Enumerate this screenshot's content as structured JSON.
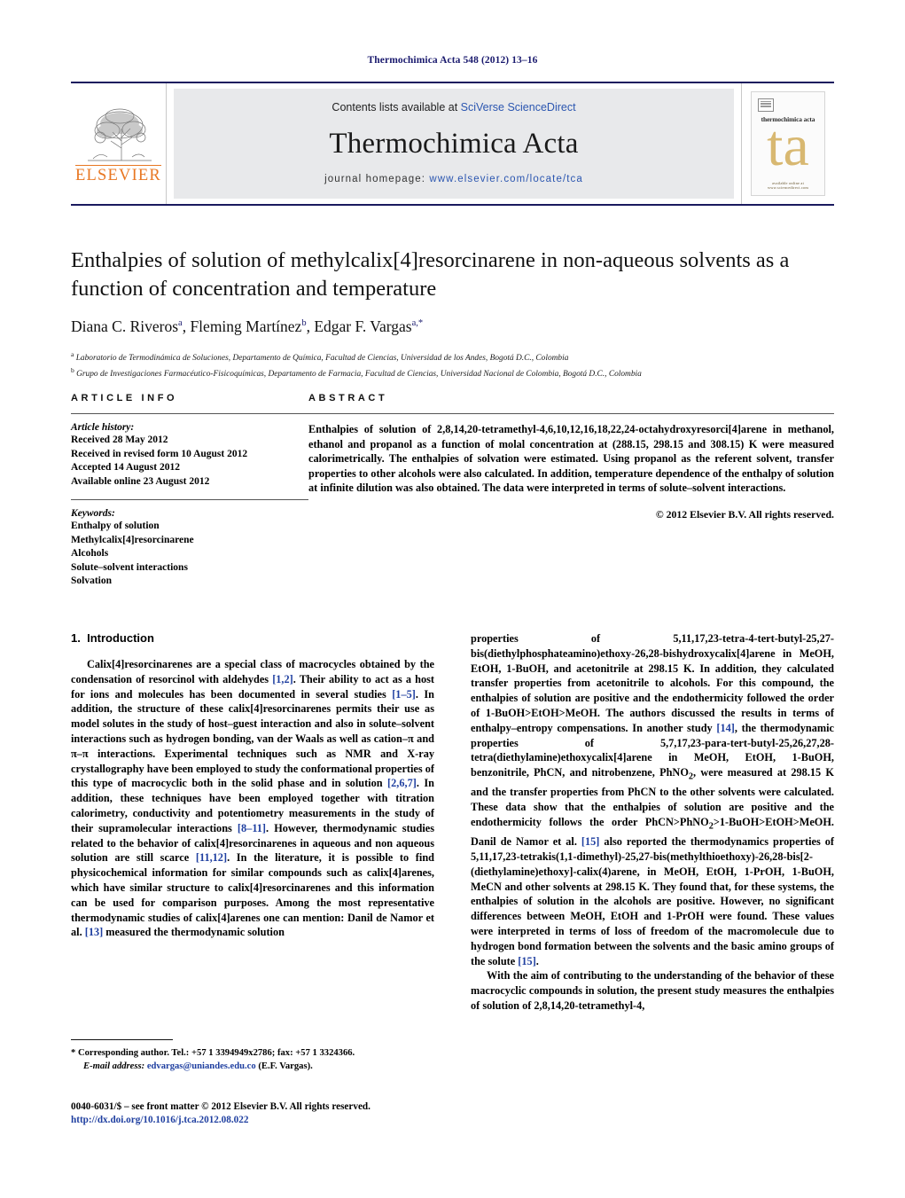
{
  "running_head": "Thermochimica Acta 548 (2012) 13–16",
  "masthead": {
    "publisher_logo_label": "ELSEVIER",
    "contents_prefix": "Contents lists available at ",
    "contents_link": "SciVerse ScienceDirect",
    "journal_name": "Thermochimica Acta",
    "homepage_prefix": "journal homepage: ",
    "homepage_url": "www.elsevier.com/locate/tca",
    "cover": {
      "title": "thermochimica acta",
      "monogram": "ta",
      "footer": "available online at www.sciencedirect.com"
    }
  },
  "article": {
    "title": "Enthalpies of solution of methylcalix[4]resorcinarene in non-aqueous solvents as a function of concentration and temperature",
    "authors_html": "Diana C. Riveros<sup>a</sup>, Fleming Martínez<sup>b</sup>, Edgar F. Vargas<sup>a,*</sup>",
    "affiliations": [
      "Laboratorio de Termodinámica de Soluciones, Departamento de Química, Facultad de Ciencias, Universidad de los Andes, Bogotá D.C., Colombia",
      "Grupo de Investigaciones Farmacéutico-Fisicoquímicas, Departamento de Farmacia, Facultad de Ciencias, Universidad Nacional de Colombia, Bogotá D.C., Colombia"
    ],
    "affiliation_marks": [
      "a",
      "b"
    ]
  },
  "article_info": {
    "heading": "ARTICLE INFO",
    "history_label": "Article history:",
    "history": [
      "Received 28 May 2012",
      "Received in revised form 10 August 2012",
      "Accepted 14 August 2012",
      "Available online 23 August 2012"
    ],
    "keywords_label": "Keywords:",
    "keywords": [
      "Enthalpy of solution",
      "Methylcalix[4]resorcinarene",
      "Alcohols",
      "Solute–solvent interactions",
      "Solvation"
    ]
  },
  "abstract": {
    "heading": "ABSTRACT",
    "text": "Enthalpies of solution of 2,8,14,20-tetramethyl-4,6,10,12,16,18,22,24-octahydroxyresorci[4]arene in methanol, ethanol and propanol as a function of molal concentration at (288.15, 298.15 and 308.15) K were measured calorimetrically. The enthalpies of solvation were estimated. Using propanol as the referent solvent, transfer properties to other alcohols were also calculated. In addition, temperature dependence of the enthalpy of solution at infinite dilution was also obtained. The data were interpreted in terms of solute–solvent interactions.",
    "copyright": "© 2012 Elsevier B.V. All rights reserved."
  },
  "introduction": {
    "section_number": "1.",
    "section_title": "Introduction",
    "left_column_html": "Calix[4]resorcinarenes are a special class of macrocycles obtained by the condensation of resorcinol with aldehydes <span class=\"cite\">[1,2]</span>. Their ability to act as a host for ions and molecules has been documented in several studies <span class=\"cite\">[1–5]</span>. In addition, the structure of these calix[4]resorcinarenes permits their use as model solutes in the study of host–guest interaction and also in solute–solvent interactions such as hydrogen bonding, van der Waals as well as cation–π and π–π interactions. Experimental techniques such as NMR and X-ray crystallography have been employed to study the conformational properties of this type of macrocyclic both in the solid phase and in solution <span class=\"cite\">[2,6,7]</span>. In addition, these techniques have been employed together with titration calorimetry, conductivity and potentiometry measurements in the study of their supramolecular interactions <span class=\"cite\">[8–11]</span>. However, thermodynamic studies related to the behavior of calix[4]resorcinarenes in aqueous and non aqueous solution are still scarce <span class=\"cite\">[11,12]</span>. In the literature, it is possible to find physicochemical information for similar compounds such as calix[4]arenes, which have similar structure to calix[4]resorcinarenes and this information can be used for comparison purposes. Among the most representative thermodynamic studies of calix[4]arenes one can mention: Danil de Namor et al. <span class=\"cite\">[13]</span> measured the thermodynamic solution",
    "right_column_html": "properties of 5,11,17,23-tetra-4-tert-butyl-25,27-bis(diethylphosphateamino)ethoxy-26,28-bishydroxycalix[4]arene in MeOH, EtOH, 1-BuOH, and acetonitrile at 298.15 K. In addition, they calculated transfer properties from acetonitrile to alcohols. For this compound, the enthalpies of solution are positive and the endothermicity followed the order of 1-BuOH&gt;EtOH&gt;MeOH. The authors discussed the results in terms of enthalpy–entropy compensations. In another study <span class=\"cite\">[14]</span>, the thermodynamic properties of 5,7,17,23-para-tert-butyl-25,26,27,28-tetra(diethylamine)ethoxycalix[4]arene in MeOH, EtOH, 1-BuOH, benzonitrile, PhCN, and nitrobenzene, PhNO<sub>2</sub>, were measured at 298.15 K and the transfer properties from PhCN to the other solvents were calculated. These data show that the enthalpies of solution are positive and the endothermicity follows the order PhCN&gt;PhNO<sub>2</sub>&gt;1-BuOH&gt;EtOH&gt;MeOH. Danil de Namor et al. <span class=\"cite\">[15]</span> also reported the thermodynamics properties of 5,11,17,23-tetrakis(1,1-dimethyl)-25,27-bis(methylthioethoxy)-26,28-bis[2-(diethylamine)ethoxy]-calix(4)arene, in MeOH, EtOH, 1-PrOH, 1-BuOH, MeCN and other solvents at 298.15 K. They found that, for these systems, the enthalpies of solution in the alcohols are positive. However, no significant differences between MeOH, EtOH and 1-PrOH were found. These values were interpreted in terms of loss of freedom of the macromolecule due to hydrogen bond formation between the solvents and the basic amino groups of the solute <span class=\"cite\">[15]</span>.",
    "right_column_last_html": "With the aim of contributing to the understanding of the behavior of these macrocyclic compounds in solution, the present study measures the enthalpies of solution of 2,8,14,20-tetramethyl-4,"
  },
  "footnote": {
    "corresponding_html": "* Corresponding author. Tel.: +57 1 3394949x2786; fax: +57 1 3324366.",
    "email_label": "E-mail address:",
    "email": "edvargas@uniandes.edu.co",
    "email_person": "(E.F. Vargas)."
  },
  "imprint": {
    "issn_line": "0040-6031/$ – see front matter © 2012 Elsevier B.V. All rights reserved.",
    "doi": "http://dx.doi.org/10.1016/j.tca.2012.08.022"
  }
}
